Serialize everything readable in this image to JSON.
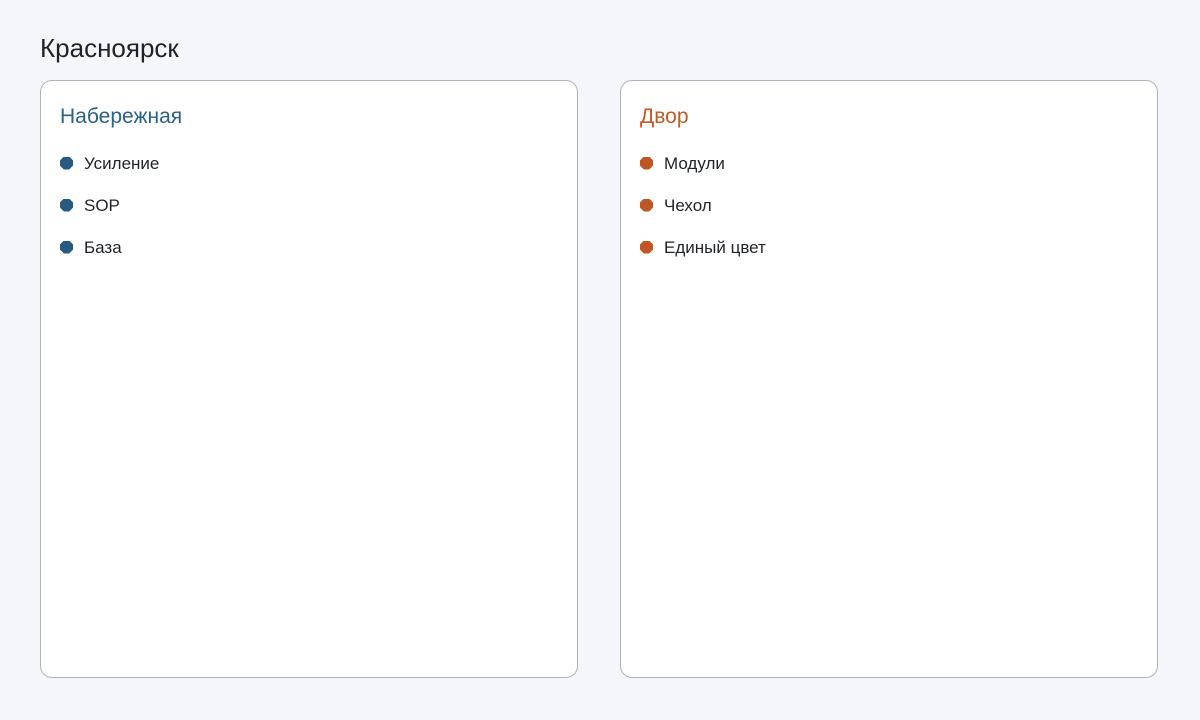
{
  "page": {
    "title": "Красноярск"
  },
  "columns": [
    {
      "title": "Набережная",
      "color": "#2a6187",
      "items": [
        "Усиление",
        "SOP",
        "База"
      ]
    },
    {
      "title": "Двор",
      "color": "#c35a24",
      "items": [
        "Модули",
        "Чехол",
        "Единый цвет"
      ]
    }
  ]
}
